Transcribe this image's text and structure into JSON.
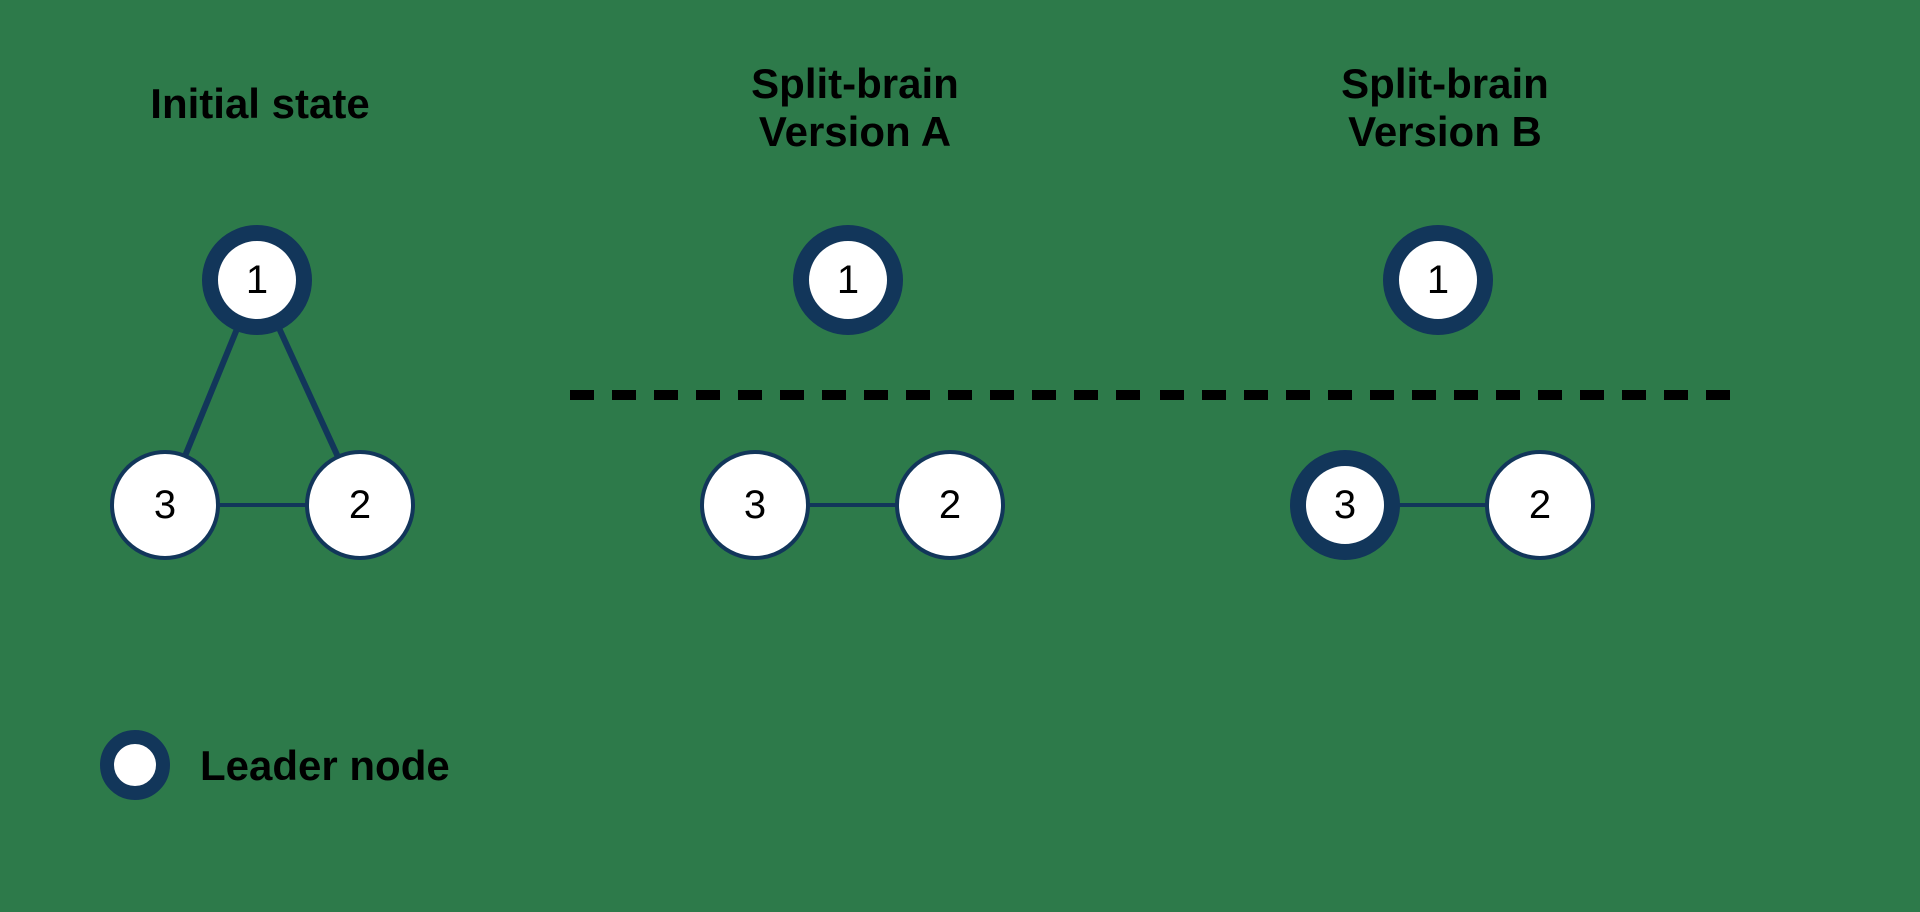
{
  "titles": {
    "initial": "Initial state",
    "versionA": "Split-brain\nVersion A",
    "versionB": "Split-brain\nVersion B"
  },
  "nodes": {
    "n1": "1",
    "n2": "2",
    "n3": "3"
  },
  "legend": {
    "leader": "Leader node"
  },
  "chart_data": {
    "type": "diagram",
    "description": "Three-node cluster topology showing initial fully-connected state and two split-brain scenarios after network partition.",
    "legend": "Thick-bordered circle = Leader node",
    "scenarios": [
      {
        "name": "Initial state",
        "nodes": [
          {
            "id": 1,
            "role": "leader"
          },
          {
            "id": 2,
            "role": "follower"
          },
          {
            "id": 3,
            "role": "follower"
          }
        ],
        "edges": [
          [
            1,
            2
          ],
          [
            1,
            3
          ],
          [
            2,
            3
          ]
        ],
        "partition": null
      },
      {
        "name": "Split-brain Version A",
        "nodes": [
          {
            "id": 1,
            "role": "leader"
          },
          {
            "id": 2,
            "role": "follower"
          },
          {
            "id": 3,
            "role": "follower"
          }
        ],
        "edges": [
          [
            2,
            3
          ]
        ],
        "partition": [
          [
            1
          ],
          [
            2,
            3
          ]
        ]
      },
      {
        "name": "Split-brain Version B",
        "nodes": [
          {
            "id": 1,
            "role": "leader"
          },
          {
            "id": 2,
            "role": "follower"
          },
          {
            "id": 3,
            "role": "leader"
          }
        ],
        "edges": [
          [
            2,
            3
          ]
        ],
        "partition": [
          [
            1
          ],
          [
            2,
            3
          ]
        ]
      }
    ]
  }
}
